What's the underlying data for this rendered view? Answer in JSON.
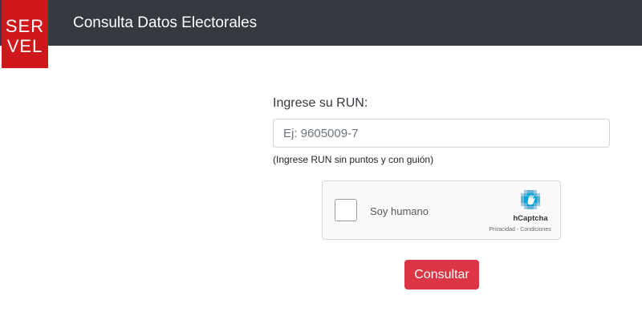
{
  "header": {
    "logo_line1": "SER",
    "logo_line2": "VEL",
    "title": "Consulta Datos Electorales"
  },
  "form": {
    "label": "Ingrese su RUN:",
    "input_value": "",
    "input_placeholder": "Ej: 9605009-7",
    "help_text": "(Ingrese RUN sin puntos y con guión)",
    "submit_label": "Consultar"
  },
  "captcha": {
    "checkbox_label": "Soy humano",
    "brand": "hCaptcha",
    "privacy_link": "Privacidad",
    "separator": " - ",
    "terms_link": "Condiciones",
    "checked": false
  },
  "colors": {
    "navbar": "#343a40",
    "logo": "#d0171b",
    "button": "#dc3545"
  }
}
